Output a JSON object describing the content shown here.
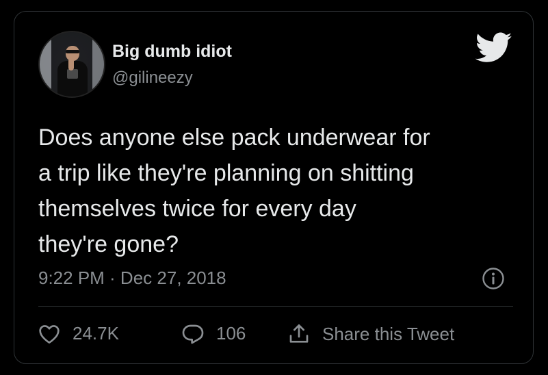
{
  "tweet": {
    "author": {
      "display_name": "Big dumb idiot",
      "handle": "@gilineezy"
    },
    "text": "Does anyone else pack underwear for\na trip like they're planning on shitting\nthemselves twice for every day\nthey're gone?",
    "timestamp": "9:22 PM · Dec 27, 2018",
    "likes": "24.7K",
    "replies": "106",
    "share_label": "Share this Tweet"
  },
  "icons": {
    "brand": "twitter-bird-icon",
    "info": "info-icon",
    "like": "heart-icon",
    "reply": "comment-icon",
    "share": "share-icon"
  },
  "colors": {
    "background": "#000000",
    "text_primary": "#e7e9ea",
    "text_secondary": "#8b8f93",
    "border": "#2f3336"
  }
}
